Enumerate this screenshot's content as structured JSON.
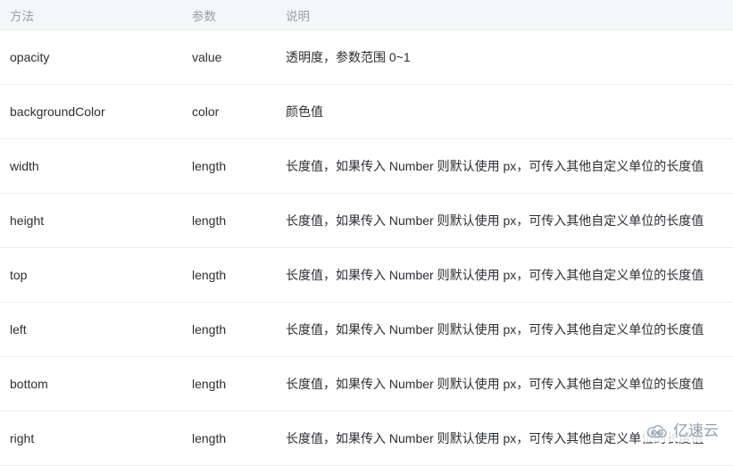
{
  "table": {
    "columns": [
      {
        "key": "method",
        "label": "方法"
      },
      {
        "key": "param",
        "label": "参数"
      },
      {
        "key": "desc",
        "label": "说明"
      }
    ],
    "rows": [
      {
        "method": "opacity",
        "param": "value",
        "desc": "透明度，参数范围 0~1"
      },
      {
        "method": "backgroundColor",
        "param": "color",
        "desc": "颜色值"
      },
      {
        "method": "width",
        "param": "length",
        "desc": "长度值，如果传入 Number 则默认使用 px，可传入其他自定义单位的长度值"
      },
      {
        "method": "height",
        "param": "length",
        "desc": "长度值，如果传入 Number 则默认使用 px，可传入其他自定义单位的长度值"
      },
      {
        "method": "top",
        "param": "length",
        "desc": "长度值，如果传入 Number 则默认使用 px，可传入其他自定义单位的长度值"
      },
      {
        "method": "left",
        "param": "length",
        "desc": "长度值，如果传入 Number 则默认使用 px，可传入其他自定义单位的长度值"
      },
      {
        "method": "bottom",
        "param": "length",
        "desc": "长度值，如果传入 Number 则默认使用 px，可传入其他自定义单位的长度值"
      },
      {
        "method": "right",
        "param": "length",
        "desc": "长度值，如果传入 Number 则默认使用 px，可传入其他自定义单位的长度值"
      }
    ]
  },
  "watermark": {
    "text": "亿速云",
    "logo_icon": "cloud-swirl-icon",
    "color": "#8b95a6"
  },
  "theme": {
    "header_background": "#f5f6f8",
    "header_text": "#9b9ea3",
    "body_text": "#2c2f33",
    "divider": "#ebedef",
    "page_background": "#ffffff"
  }
}
